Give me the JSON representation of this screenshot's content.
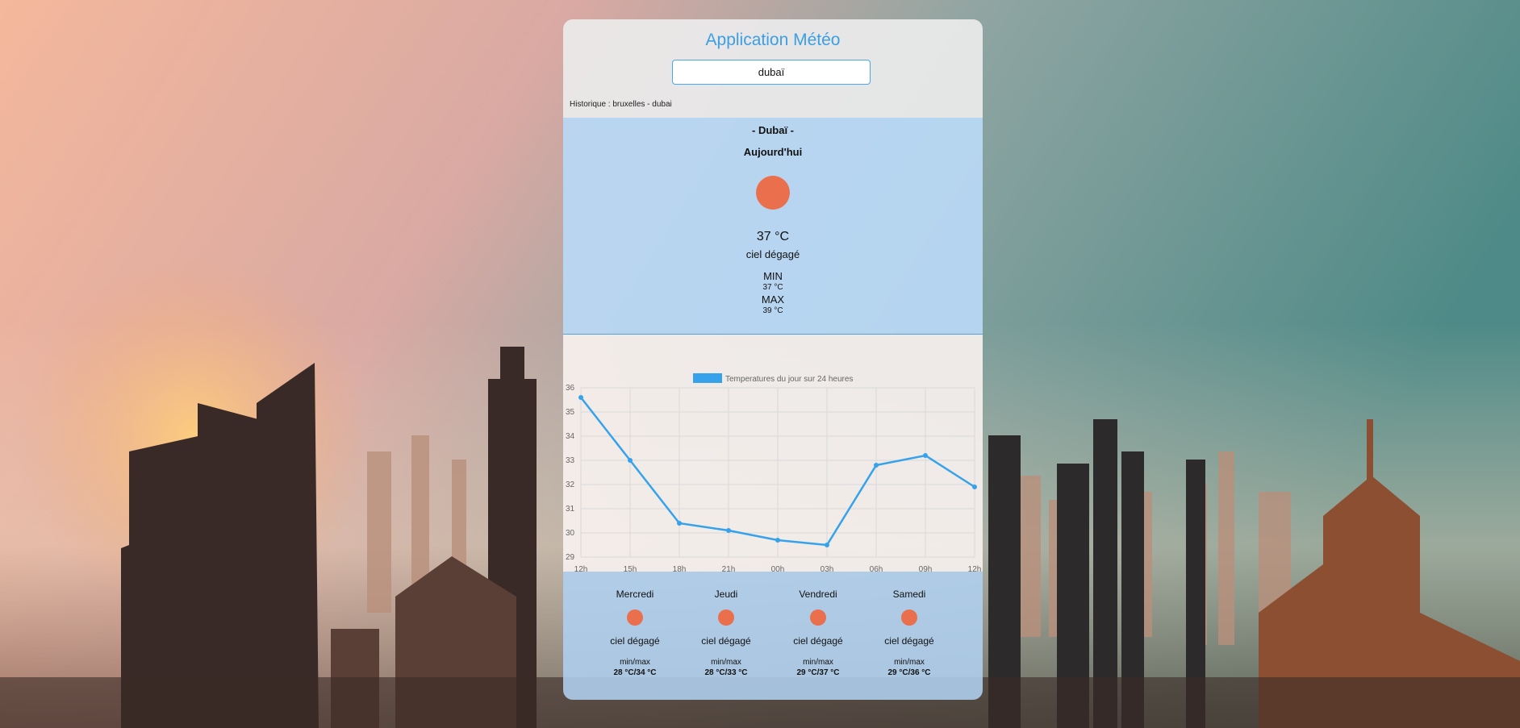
{
  "app": {
    "title": "Application Météo"
  },
  "search": {
    "value": "dubaï"
  },
  "history": {
    "text": "Historique : bruxelles - dubai"
  },
  "today": {
    "city": "- Dubaï -",
    "day": "Aujourd'hui",
    "icon": "sun-icon",
    "temp": "37 °C",
    "description": "ciel dégagé",
    "min_label": "MIN",
    "min_value": "37 °C",
    "max_label": "MAX",
    "max_value": "39 °C"
  },
  "chart_data": {
    "type": "line",
    "title": "",
    "legend": "Temperatures du jour sur 24 heures",
    "legend_placement": "top-center",
    "color": "#36a2eb",
    "x": [
      "12h",
      "15h",
      "18h",
      "21h",
      "00h",
      "03h",
      "06h",
      "09h",
      "12h"
    ],
    "series": [
      {
        "name": "Temperatures du jour sur 24 heures",
        "values": [
          35.6,
          33.0,
          30.4,
          30.1,
          29.7,
          29.5,
          32.8,
          33.2,
          31.9
        ]
      }
    ],
    "ylim": [
      29,
      36
    ],
    "yticks": [
      29,
      30,
      31,
      32,
      33,
      34,
      35,
      36
    ],
    "grid": true
  },
  "forecast": [
    {
      "day": "Mercredi",
      "icon": "sun-icon",
      "description": "ciel dégagé",
      "label": "min/max",
      "range": "28 °C/34 °C"
    },
    {
      "day": "Jeudi",
      "icon": "sun-icon",
      "description": "ciel dégagé",
      "label": "min/max",
      "range": "28 °C/33 °C"
    },
    {
      "day": "Vendredi",
      "icon": "sun-icon",
      "description": "ciel dégagé",
      "label": "min/max",
      "range": "29 °C/37 °C"
    },
    {
      "day": "Samedi",
      "icon": "sun-icon",
      "description": "ciel dégagé",
      "label": "min/max",
      "range": "29 °C/36 °C"
    }
  ],
  "colors": {
    "accent": "#3c9ee4",
    "sun": "#ea6f4c",
    "line": "#36a2eb"
  }
}
